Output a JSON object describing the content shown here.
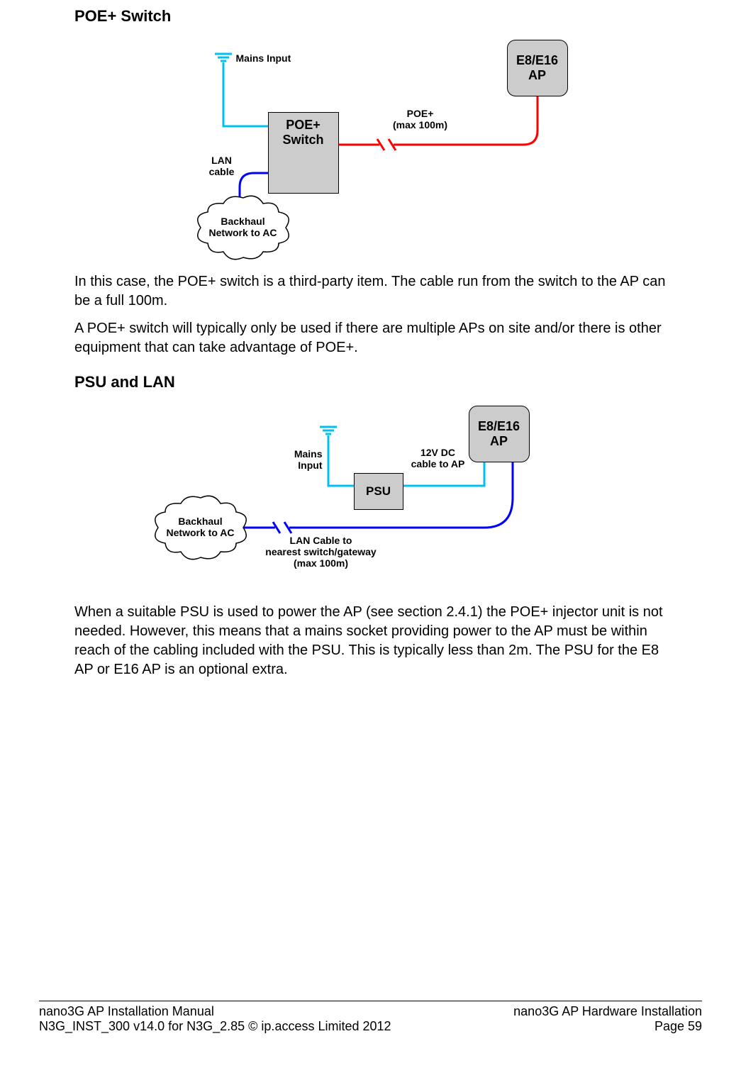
{
  "section1": {
    "heading": "POE+ Switch",
    "diagram": {
      "mains_input": "Mains Input",
      "poe_switch_l1": "POE+",
      "poe_switch_l2": "Switch",
      "lan_cable_l1": "LAN",
      "lan_cable_l2": "cable",
      "poe_l1": "POE+",
      "poe_l2": "(max 100m)",
      "ap_l1": "E8/E16",
      "ap_l2": "AP",
      "cloud_l1": "Backhaul",
      "cloud_l2": "Network to AC"
    },
    "para1": "In this case, the POE+ switch is a third-party item. The cable run from the switch to the AP can be a full 100m.",
    "para2": "A POE+ switch will typically only be used if there are multiple APs on site and/or there is other equipment that can take advantage of POE+."
  },
  "section2": {
    "heading": "PSU and LAN",
    "diagram": {
      "mains_l1": "Mains",
      "mains_l2": "Input",
      "psu": "PSU",
      "ap_l1": "E8/E16",
      "ap_l2": "AP",
      "dc_l1": "12V DC",
      "dc_l2": "cable to AP",
      "cloud_l1": "Backhaul",
      "cloud_l2": "Network to AC",
      "lan_l1": "LAN Cable to",
      "lan_l2": "nearest switch/gateway",
      "lan_l3": "(max 100m)"
    },
    "para1": "When a suitable PSU is used to power the AP (see section 2.4.1) the POE+ injector unit is not needed. However, this means that a mains socket providing power to the AP must be within reach of the cabling included with the PSU. This is typically less than 2m. The PSU for the E8 AP or E16 AP is an optional extra."
  },
  "footer": {
    "left1": "nano3G AP Installation Manual",
    "right1": "nano3G AP Hardware Installation",
    "left2": "N3G_INST_300 v14.0 for N3G_2.85 © ip.access Limited 2012",
    "right2": "Page 59"
  }
}
